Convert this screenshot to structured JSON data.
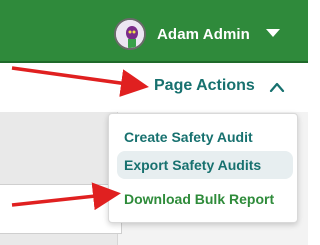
{
  "header": {
    "user_name": "Adam Admin",
    "colors": {
      "bar": "#2f8a3b",
      "text": "#ffffff"
    }
  },
  "page_actions": {
    "label": "Page Actions",
    "color": "#17716f"
  },
  "menu": {
    "items": [
      {
        "label": "Create Safety Audit",
        "state": "normal"
      },
      {
        "label": "Export Safety Audits",
        "state": "hover"
      },
      {
        "label": "Download Bulk Report",
        "state": "highlighted"
      }
    ]
  },
  "annotations": {
    "arrow_color": "#e02020"
  }
}
